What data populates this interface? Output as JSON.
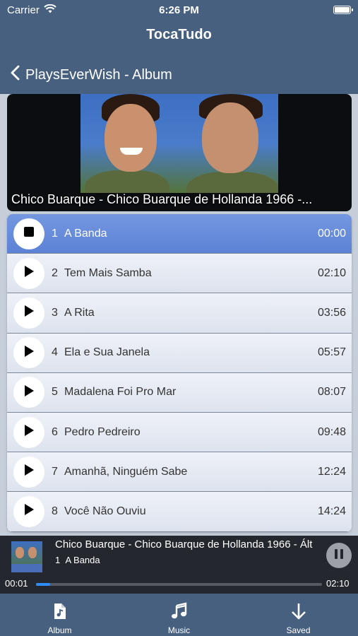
{
  "status_bar": {
    "carrier": "Carrier",
    "time": "6:26 PM"
  },
  "app": {
    "title": "TocaTudo"
  },
  "nav": {
    "back_title": "PlaysEverWish - Album"
  },
  "album": {
    "title": "Chico Buarque - Chico Buarque de Hollanda 1966 -..."
  },
  "tracks": [
    {
      "num": "1",
      "name": "A Banda",
      "time": "00:00",
      "state": "playing"
    },
    {
      "num": "2",
      "name": "Tem Mais Samba",
      "time": "02:10",
      "state": "idle"
    },
    {
      "num": "3",
      "name": "A Rita",
      "time": "03:56",
      "state": "idle"
    },
    {
      "num": "4",
      "name": "Ela e Sua Janela",
      "time": "05:57",
      "state": "idle"
    },
    {
      "num": "5",
      "name": "Madalena Foi Pro Mar",
      "time": "08:07",
      "state": "idle"
    },
    {
      "num": "6",
      "name": "Pedro Pedreiro",
      "time": "09:48",
      "state": "idle"
    },
    {
      "num": "7",
      "name": "Amanhã, Ninguém Sabe",
      "time": "12:24",
      "state": "idle"
    },
    {
      "num": "8",
      "name": "Você Não Ouviu",
      "time": "14:24",
      "state": "idle"
    }
  ],
  "player": {
    "title": "Chico Buarque - Chico Buarque de Hollanda 1966 - Ált",
    "track_num": "1",
    "track_name": "A Banda",
    "elapsed": "00:01",
    "total": "02:10",
    "progress": 0.01
  },
  "tabs": [
    {
      "label": "Album",
      "icon": "document-music-icon"
    },
    {
      "label": "Music",
      "icon": "music-note-icon"
    },
    {
      "label": "Saved",
      "icon": "download-arrow-icon"
    }
  ],
  "colors": {
    "nav_bg": "#47607f",
    "active_row": "#6a8fdd",
    "progress_fill": "#2f8cff",
    "player_bg": "#24282e"
  }
}
